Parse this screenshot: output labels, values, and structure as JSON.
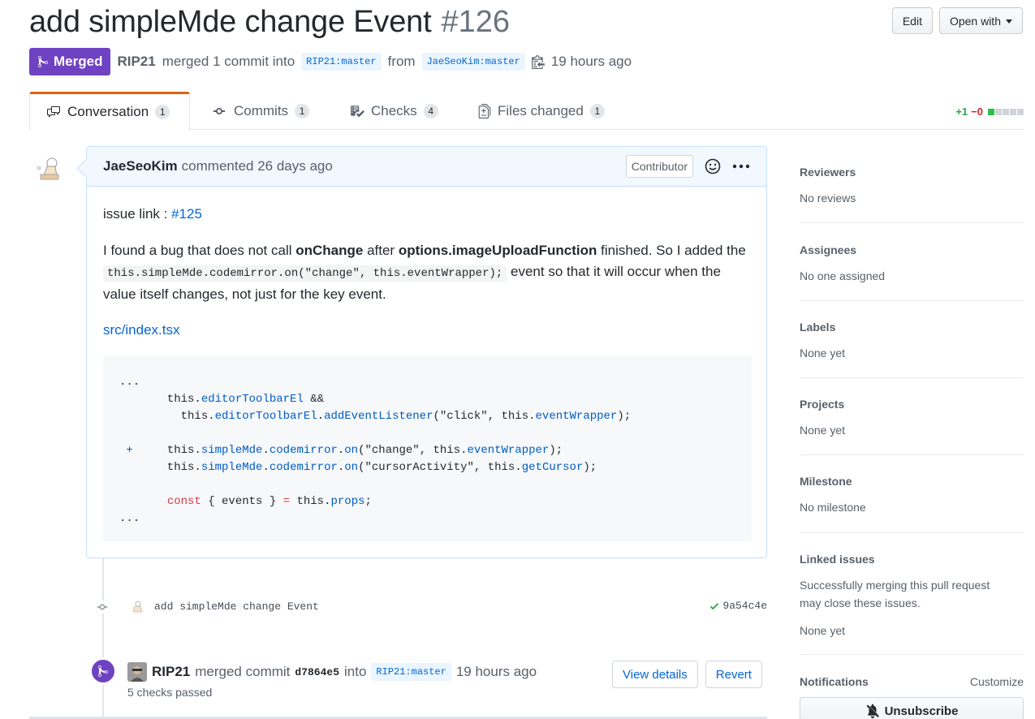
{
  "header": {
    "title": "add simpleMde change Event",
    "number": "#126",
    "edit_label": "Edit",
    "open_with_label": "Open with"
  },
  "meta": {
    "state": "Merged",
    "author": "RIP21",
    "action_text": "merged 1 commit into",
    "base_branch": "RIP21:master",
    "from_text": "from",
    "head_branch": "JaeSeoKim:master",
    "time": "19 hours ago"
  },
  "tabs": [
    {
      "label": "Conversation",
      "count": "1",
      "icon": "comment-discussion-icon"
    },
    {
      "label": "Commits",
      "count": "1",
      "icon": "git-commit-icon"
    },
    {
      "label": "Checks",
      "count": "4",
      "icon": "checklist-icon"
    },
    {
      "label": "Files changed",
      "count": "1",
      "icon": "file-diff-icon"
    }
  ],
  "diffstat": {
    "added": "+1",
    "removed": "−0"
  },
  "comment": {
    "author": "JaeSeoKim",
    "action": "commented 26 days ago",
    "role": "Contributor",
    "issue_prefix": "issue link : ",
    "issue_link": "#125",
    "body_1": "I found a bug that does not call ",
    "bold_1": "onChange",
    "body_2": " after ",
    "bold_2": "options.imageUploadFunction",
    "body_3": " finished. So I added the ",
    "code": "this.simpleMde.codemirror.on(\"change\", this.eventWrapper);",
    "body_4": " event so that it will occur when the value itself changes, not just for the key event.",
    "file_link": "src/index.tsx"
  },
  "commit": {
    "message": "add simpleMde change Event",
    "sha": "9a54c4e"
  },
  "merge_event": {
    "author": "RIP21",
    "action": "merged commit",
    "sha": "d7864e5",
    "into_text": "into",
    "branch": "RIP21:master",
    "time": "19 hours ago",
    "checks": "5 checks passed",
    "view_details": "View details",
    "revert": "Revert"
  },
  "sidebar": {
    "reviewers": {
      "title": "Reviewers",
      "value": "No reviews"
    },
    "assignees": {
      "title": "Assignees",
      "value": "No one assigned"
    },
    "labels": {
      "title": "Labels",
      "value": "None yet"
    },
    "projects": {
      "title": "Projects",
      "value": "None yet"
    },
    "milestone": {
      "title": "Milestone",
      "value": "No milestone"
    },
    "linked_issues": {
      "title": "Linked issues",
      "description": "Successfully merging this pull request may close these issues.",
      "value": "None yet"
    },
    "notifications": {
      "title": "Notifications",
      "customize": "Customize",
      "unsubscribe": "Unsubscribe"
    }
  },
  "colors": {
    "merged": "#6f42c1",
    "link": "#0366d6",
    "accent_tab": "#e36209",
    "added": "#28a745",
    "removed": "#cb2431"
  }
}
